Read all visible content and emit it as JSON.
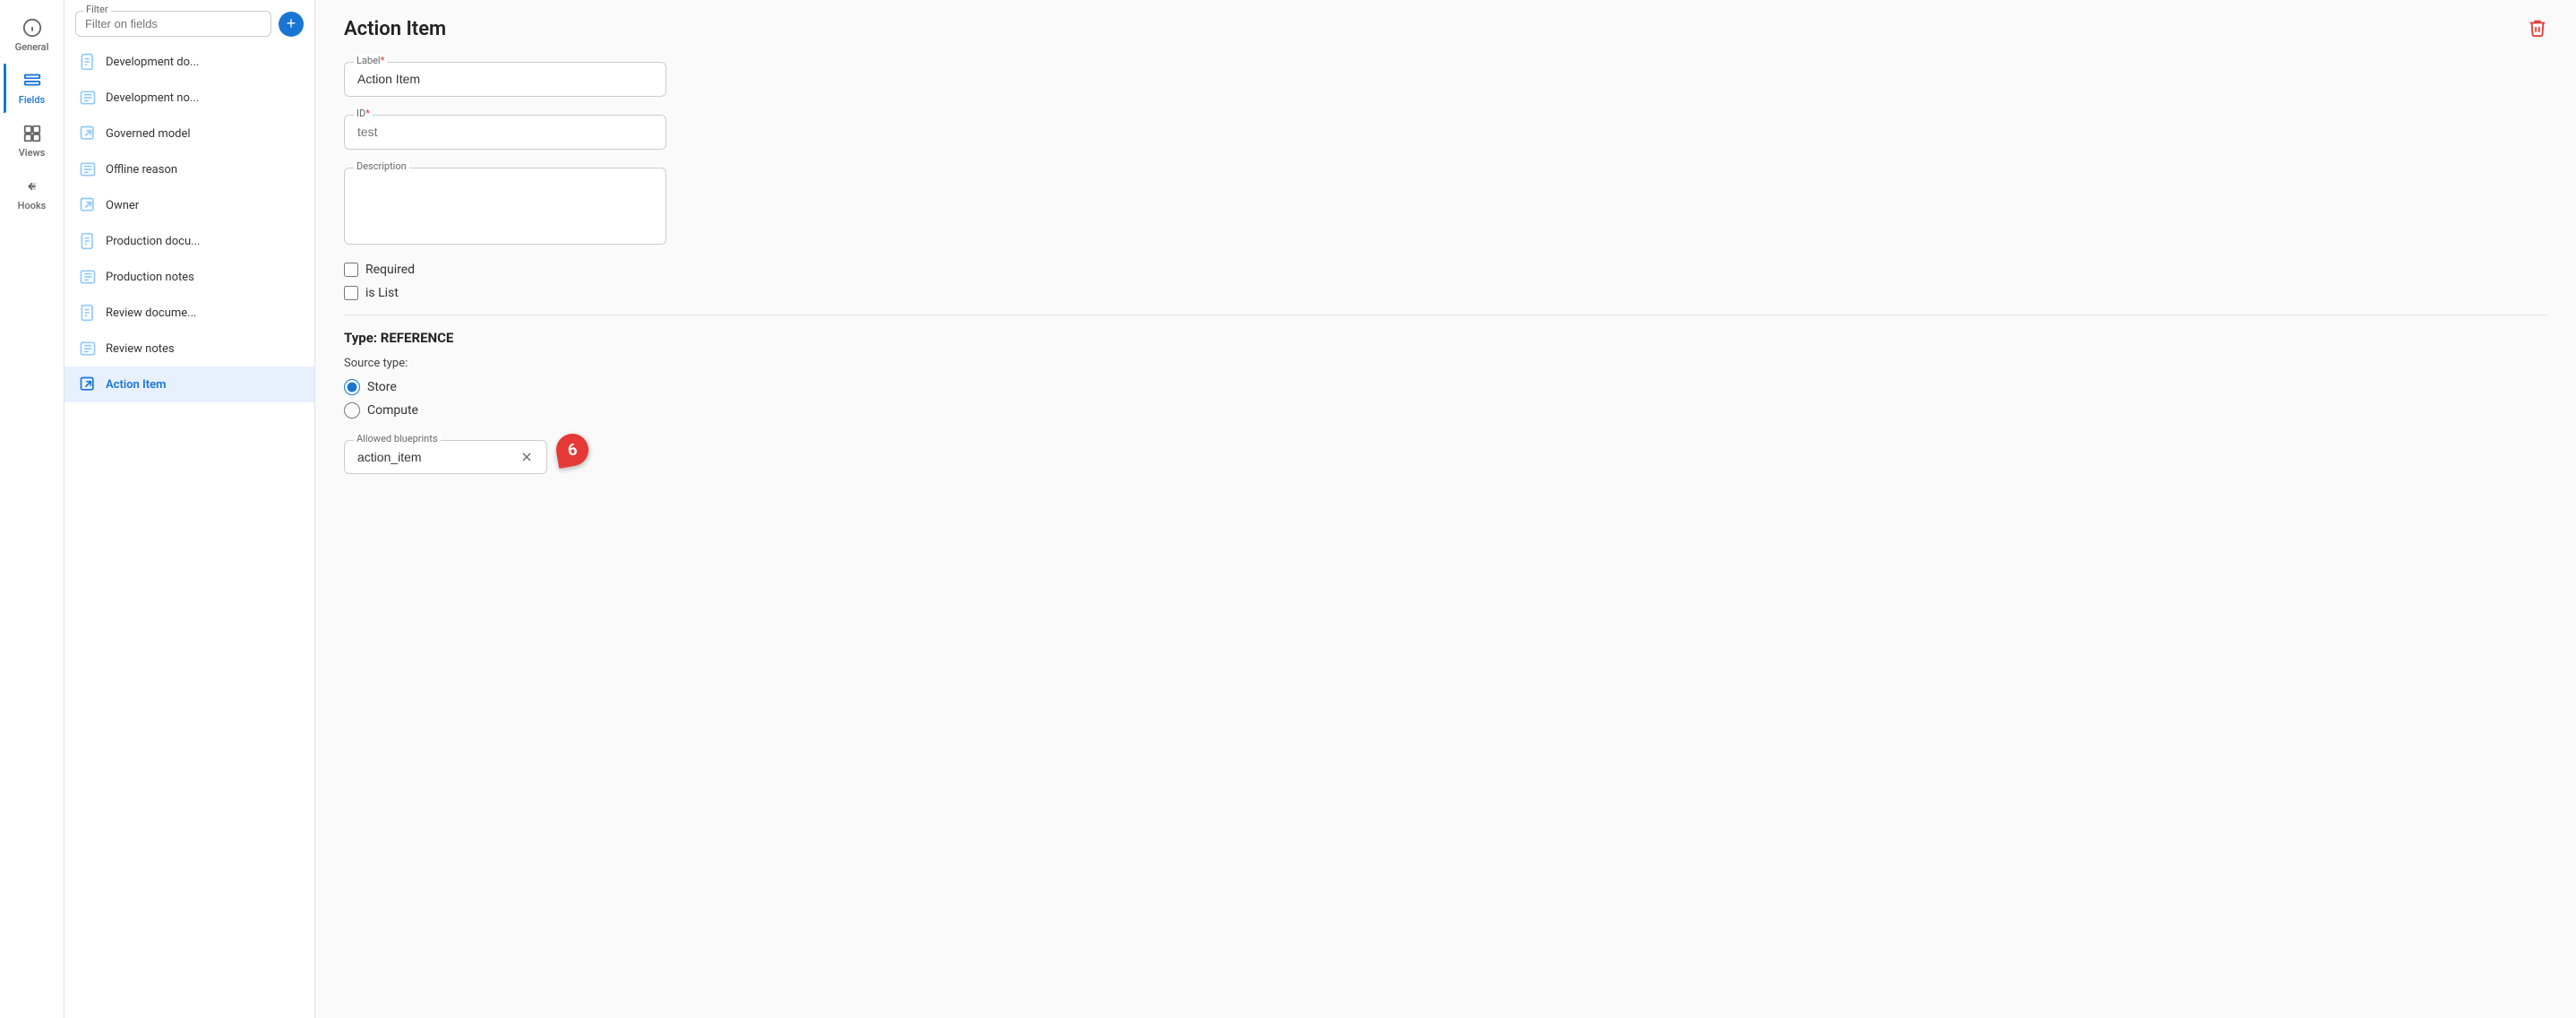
{
  "sidebar": {
    "items": [
      {
        "id": "general",
        "label": "General",
        "icon": "info-circle"
      },
      {
        "id": "fields",
        "label": "Fields",
        "icon": "fields",
        "active": true
      },
      {
        "id": "views",
        "label": "Views",
        "icon": "views"
      },
      {
        "id": "hooks",
        "label": "Hooks",
        "icon": "hooks"
      }
    ]
  },
  "filter": {
    "label": "Filter",
    "placeholder": "Filter on fields"
  },
  "fields_list": [
    {
      "id": "development_do",
      "label": "Development do...",
      "icon": "document",
      "selected": false
    },
    {
      "id": "development_no",
      "label": "Development no...",
      "icon": "text",
      "selected": false
    },
    {
      "id": "governed_model",
      "label": "Governed model",
      "icon": "external",
      "selected": false
    },
    {
      "id": "offline_reason",
      "label": "Offline reason",
      "icon": "text",
      "selected": false
    },
    {
      "id": "owner",
      "label": "Owner",
      "icon": "external",
      "selected": false
    },
    {
      "id": "production_docu",
      "label": "Production docu...",
      "icon": "document",
      "selected": false
    },
    {
      "id": "production_notes",
      "label": "Production notes",
      "icon": "text",
      "selected": false
    },
    {
      "id": "review_docume",
      "label": "Review docume...",
      "icon": "document",
      "selected": false
    },
    {
      "id": "review_notes",
      "label": "Review notes",
      "icon": "text",
      "selected": false
    },
    {
      "id": "action_item",
      "label": "Action Item",
      "icon": "external",
      "selected": true
    }
  ],
  "form": {
    "title": "Action Item",
    "label_field": {
      "label": "Label",
      "required": true,
      "value": "Action Item"
    },
    "id_field": {
      "label": "ID",
      "required": true,
      "placeholder": "test",
      "value": ""
    },
    "description_field": {
      "label": "Description",
      "value": ""
    },
    "required_checkbox": {
      "label": "Required",
      "checked": false
    },
    "is_list_checkbox": {
      "label": "is List",
      "checked": false
    },
    "type_label": "Type: REFERENCE",
    "source_type": {
      "label": "Source type:",
      "options": [
        {
          "value": "store",
          "label": "Store",
          "selected": true
        },
        {
          "value": "compute",
          "label": "Compute",
          "selected": false
        }
      ]
    },
    "allowed_blueprints": {
      "label": "Allowed blueprints",
      "value": "action_item"
    },
    "badge": {
      "value": "6",
      "color": "#e53935"
    }
  },
  "delete_button": "🗑"
}
